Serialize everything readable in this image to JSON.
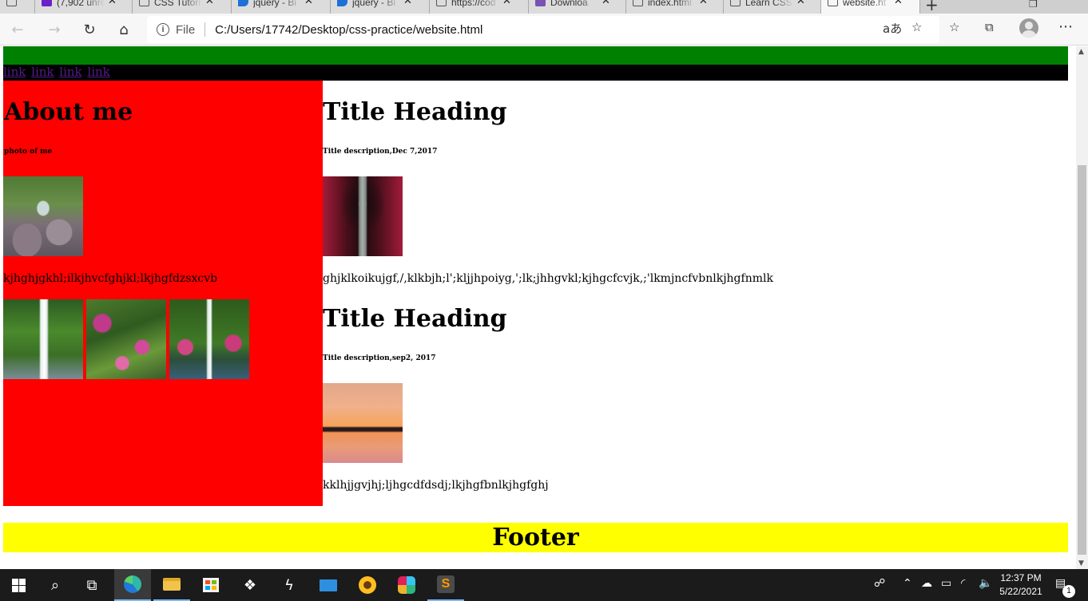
{
  "browser": {
    "tabs": [
      {
        "title": "(7,902 unre",
        "favicon": "yahoo-mail-icon"
      },
      {
        "title": "CSS Tutori",
        "favicon": "w3schools-icon"
      },
      {
        "title": "jquery - Bi",
        "favicon": "bing-icon"
      },
      {
        "title": "jquery - Bi",
        "favicon": "bing-icon"
      },
      {
        "title": "https://cod",
        "favicon": "page-icon"
      },
      {
        "title": "Downloa",
        "favicon": "bootstrap-icon"
      },
      {
        "title": "index.html",
        "favicon": "page-icon"
      },
      {
        "title": "Learn CSS",
        "favicon": "w3schools-icon"
      },
      {
        "title": "website.ht",
        "favicon": "page-icon",
        "active": true
      }
    ],
    "address": {
      "scheme_label": "File",
      "url": "C:/Users/17742/Desktop/css-practice/website.html"
    }
  },
  "page": {
    "nav_links": [
      "link",
      "link",
      "link",
      "link"
    ],
    "sidebar": {
      "heading": "About me",
      "subheading": "photo of me",
      "text": "kjhghjgkhl;ilkjhvcfghjkl;lkjhgfdzsxcvb"
    },
    "posts": [
      {
        "title": "Title Heading",
        "description": "Title description,Dec 7,2017",
        "body": "ghjklkoikujgf,/,klkbjh;l';kljjhpoiyg,';lk;jhhgvkl;kjhgcfcvjk,;'lkmjncfvbnlkjhgfnmlk"
      },
      {
        "title": "Title Heading",
        "description": "Title description,sep2, 2017",
        "body": "kklhjjgvjhj;ljhgcdfdsdj;lkjhgfbnlkjhgfghj"
      }
    ],
    "footer": "Footer",
    "colors": {
      "banner": "#008000",
      "nav_bg": "#000000",
      "sidebar_bg": "#ff0000",
      "footer_bg": "#ffff00"
    }
  },
  "taskbar": {
    "time": "12:37 PM",
    "date": "5/22/2021",
    "notification_count": "1"
  }
}
